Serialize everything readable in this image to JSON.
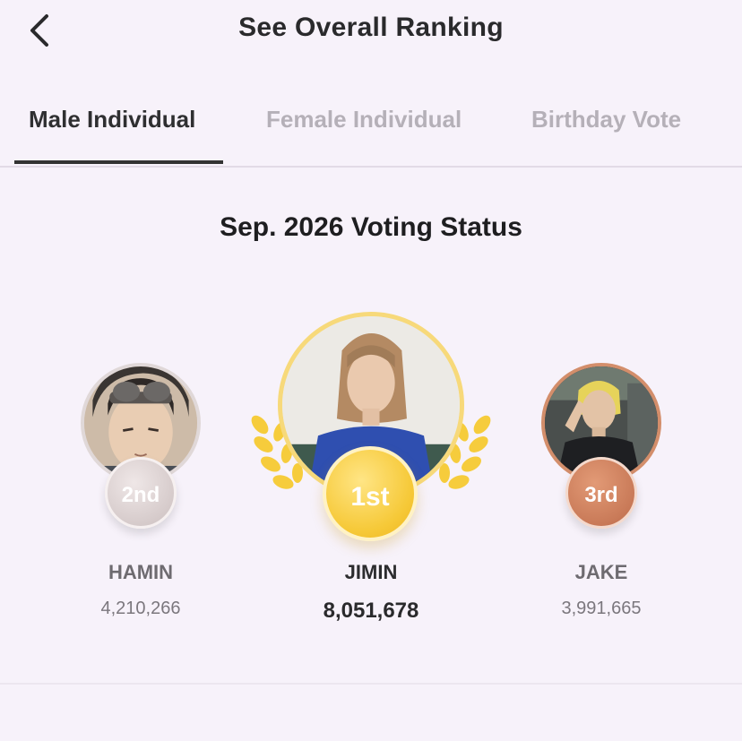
{
  "header": {
    "title": "See Overall Ranking",
    "back_icon": "chevron-left-icon"
  },
  "tabs": [
    {
      "label": "Male Individual",
      "active": true
    },
    {
      "label": "Female Individual",
      "active": false
    },
    {
      "label": "Birthday Vote",
      "active": false
    }
  ],
  "status": {
    "title": "Sep. 2026 Voting Status"
  },
  "ranking": [
    {
      "rank": "1st",
      "name": "JIMIN",
      "votes": "8,051,678",
      "medal_color": "#f3c22f"
    },
    {
      "rank": "2nd",
      "name": "HAMIN",
      "votes": "4,210,266",
      "medal_color": "#d8cece"
    },
    {
      "rank": "3rd",
      "name": "JAKE",
      "votes": "3,991,665",
      "medal_color": "#c97a58"
    }
  ],
  "colors": {
    "background": "#f7f2fa",
    "gold_ring": "#f7d97a",
    "laurel": "#f6cc3c"
  }
}
